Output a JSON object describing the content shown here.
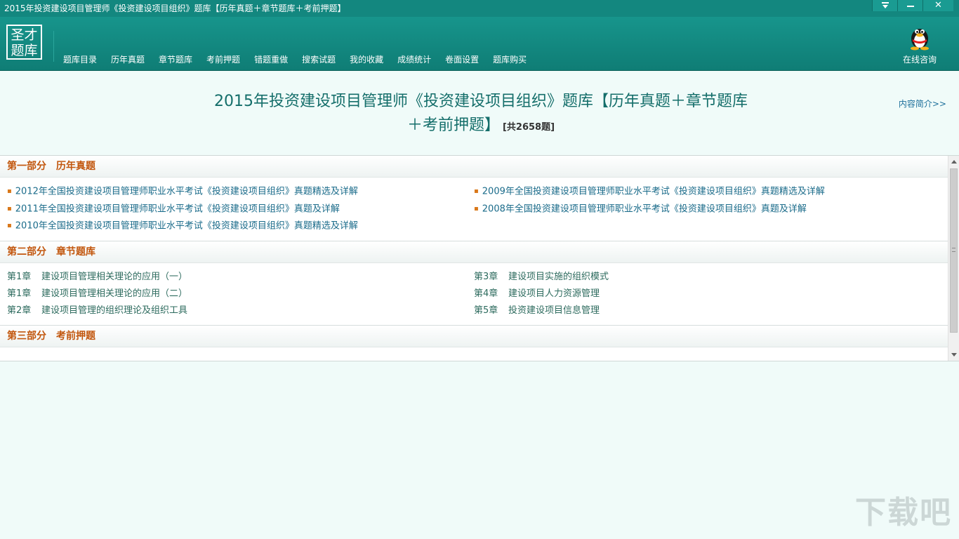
{
  "window": {
    "title": "2015年投资建设项目管理师《投资建设项目组织》题库【历年真题＋章节题库＋考前押题】"
  },
  "logo": {
    "line1": "圣才",
    "line2": "题库"
  },
  "nav": {
    "items": [
      {
        "label": "题库目录"
      },
      {
        "label": "历年真题"
      },
      {
        "label": "章节题库"
      },
      {
        "label": "考前押题"
      },
      {
        "label": "错题重做"
      },
      {
        "label": "搜索试题"
      },
      {
        "label": "我的收藏"
      },
      {
        "label": "成绩统计"
      },
      {
        "label": "卷面设置"
      },
      {
        "label": "题库购买"
      }
    ],
    "consult_label": "在线咨询"
  },
  "book": {
    "title_line1": "2015年投资建设项目管理师《投资建设项目组织》题库【历年真题＋章节题库",
    "title_line2": "＋考前押题】",
    "count": "[共2658题]",
    "intro_link": "内容简介>>"
  },
  "sections": [
    {
      "part": "第一部分",
      "name": "历年真题",
      "left": [
        "2012年全国投资建设项目管理师职业水平考试《投资建设项目组织》真题精选及详解",
        "2011年全国投资建设项目管理师职业水平考试《投资建设项目组织》真题及详解",
        "2010年全国投资建设项目管理师职业水平考试《投资建设项目组织》真题精选及详解"
      ],
      "right": [
        "2009年全国投资建设项目管理师职业水平考试《投资建设项目组织》真题精选及详解",
        "2008年全国投资建设项目管理师职业水平考试《投资建设项目组织》真题及详解"
      ]
    },
    {
      "part": "第二部分",
      "name": "章节题库",
      "chapters_left": [
        {
          "no": "第1章",
          "title": "建设项目管理相关理论的应用（一）"
        },
        {
          "no": "第1章",
          "title": "建设项目管理相关理论的应用（二）"
        },
        {
          "no": "第2章",
          "title": "建设项目管理的组织理论及组织工具"
        }
      ],
      "chapters_right": [
        {
          "no": "第3章",
          "title": "建设项目实施的组织模式"
        },
        {
          "no": "第4章",
          "title": "建设项目人力资源管理"
        },
        {
          "no": "第5章",
          "title": "投资建设项目信息管理"
        }
      ]
    },
    {
      "part": "第三部分",
      "name": "考前押题"
    }
  ],
  "watermark": "下载吧",
  "colors": {
    "header": "#13877f",
    "section_heading": "#c2560d",
    "link": "#1a6b8a",
    "background": "#f0fbf9"
  }
}
